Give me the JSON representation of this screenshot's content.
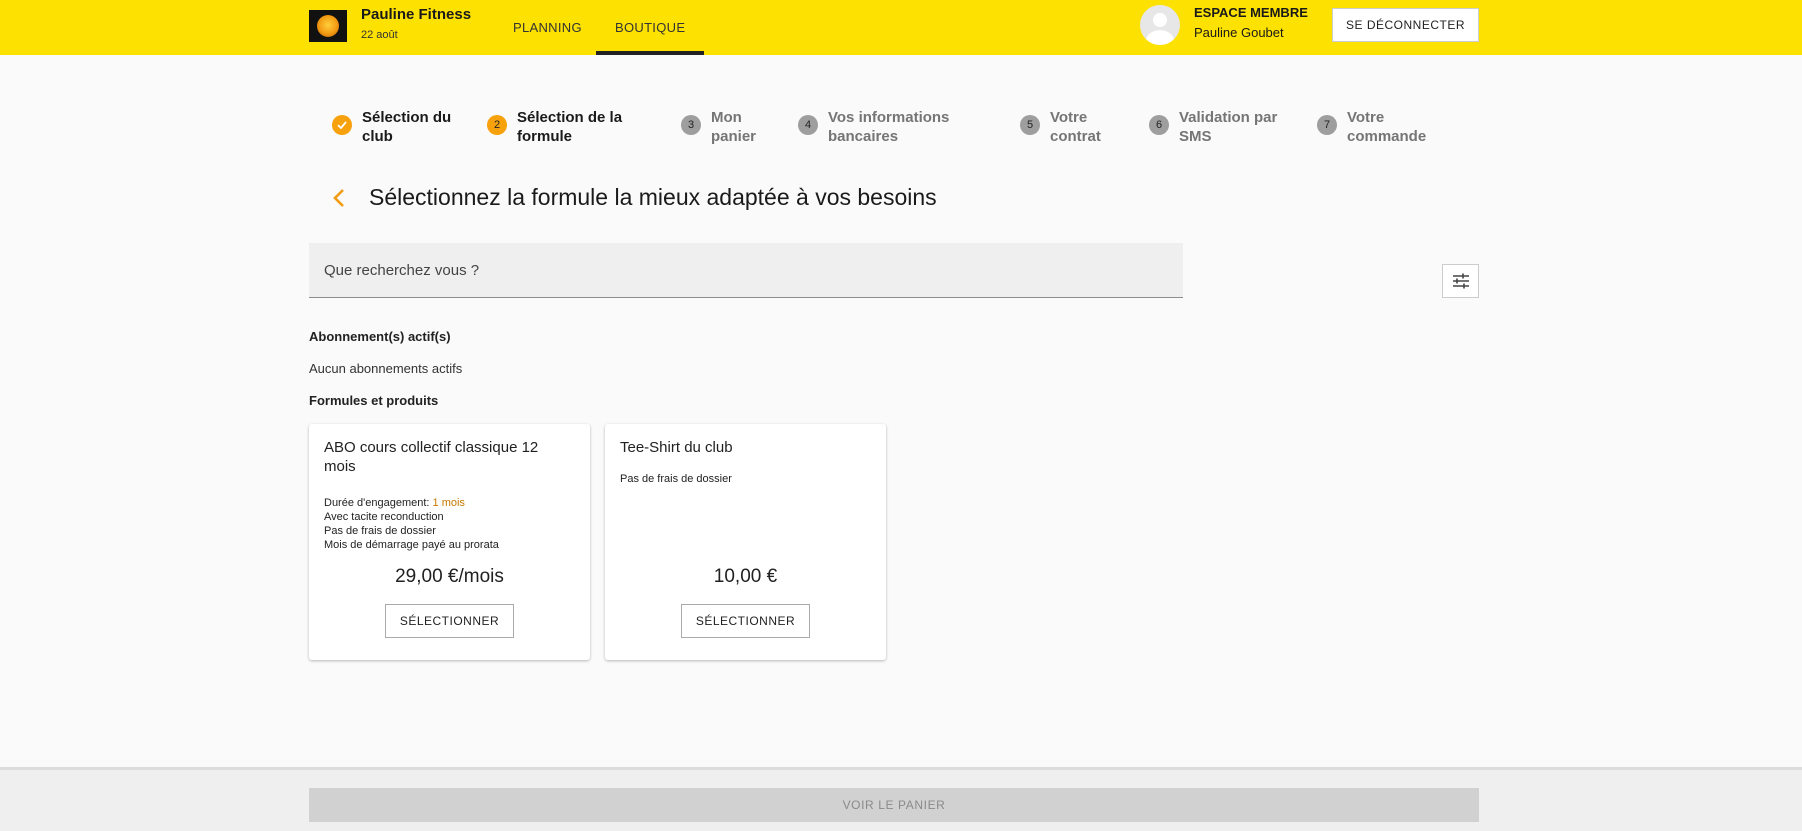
{
  "header": {
    "brand_name": "Pauline Fitness",
    "date": "22 août",
    "nav": [
      {
        "label": "PLANNING"
      },
      {
        "label": "BOUTIQUE"
      }
    ],
    "member_label": "ESPACE MEMBRE",
    "member_name": "Pauline Goubet",
    "logout_label": "SE DÉCONNECTER"
  },
  "stepper": {
    "steps": [
      {
        "number": "1",
        "label": "Sélection du club",
        "state": "done"
      },
      {
        "number": "2",
        "label": "Sélection de la formule",
        "state": "current"
      },
      {
        "number": "3",
        "label": "Mon panier",
        "state": "pending"
      },
      {
        "number": "4",
        "label": "Vos informations bancaires",
        "state": "pending"
      },
      {
        "number": "5",
        "label": "Votre contrat",
        "state": "pending"
      },
      {
        "number": "6",
        "label": "Validation par SMS",
        "state": "pending"
      },
      {
        "number": "7",
        "label": "Votre commande",
        "state": "pending"
      }
    ]
  },
  "main": {
    "title": "Sélectionnez la formule la mieux adaptée à vos besoins",
    "search_placeholder": "Que recherchez vous ?",
    "active_section_title": "Abonnement(s) actif(s)",
    "active_empty": "Aucun abonnements actifs",
    "products_section_title": "Formules et produits",
    "products": [
      {
        "title": "ABO cours collectif classique 12 mois",
        "engagement_label": "Durée d'engagement:",
        "engagement_value": "1 mois",
        "details": [
          "Avec tacite reconduction",
          "Pas de frais de dossier",
          "Mois de démarrage payé au prorata"
        ],
        "price": "29,00 €/mois",
        "button": "SÉLECTIONNER"
      },
      {
        "title": "Tee-Shirt du club",
        "details": [
          "Pas de frais de dossier"
        ],
        "price": "10,00 €",
        "button": "SÉLECTIONNER"
      }
    ]
  },
  "footer": {
    "cart_button": "VOIR LE PANIER"
  },
  "colors": {
    "header_bg": "#fde100",
    "accent_orange": "#f7a20c",
    "step_pending": "#9e9e9e"
  }
}
